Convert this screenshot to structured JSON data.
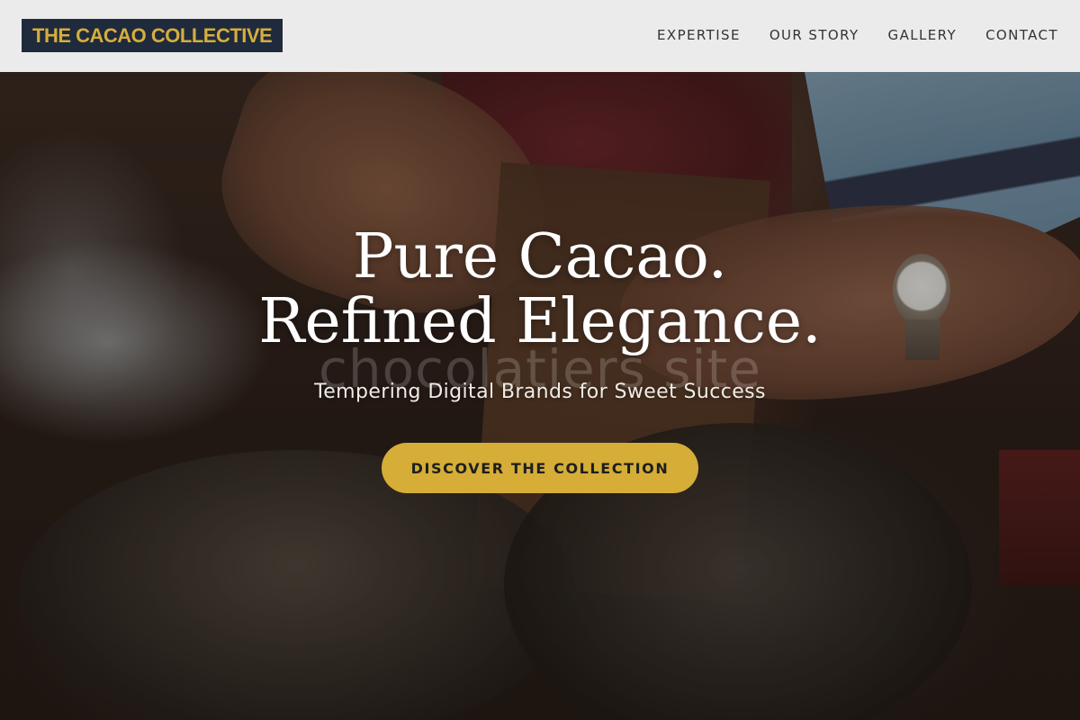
{
  "header": {
    "logo_text": "THE CACAO COLLECTIVE",
    "nav": [
      {
        "label": "EXPERTISE"
      },
      {
        "label": "OUR STORY"
      },
      {
        "label": "GALLERY"
      },
      {
        "label": "CONTACT"
      }
    ]
  },
  "hero": {
    "title_line1": "Pure Cacao.",
    "title_line2": "Refined Elegance.",
    "watermark": "chocolatiers site",
    "subtitle": "Tempering Digital Brands for Sweet Success",
    "cta_label": "DISCOVER THE COLLECTION",
    "background_description": "photo-hands-cutting-cacao"
  },
  "colors": {
    "header_bg": "#f4f4f4",
    "logo_bg": "#1f2a3c",
    "logo_text": "#d6ae3c",
    "cta_bg": "#d5ad37",
    "nav_text": "#333333"
  }
}
